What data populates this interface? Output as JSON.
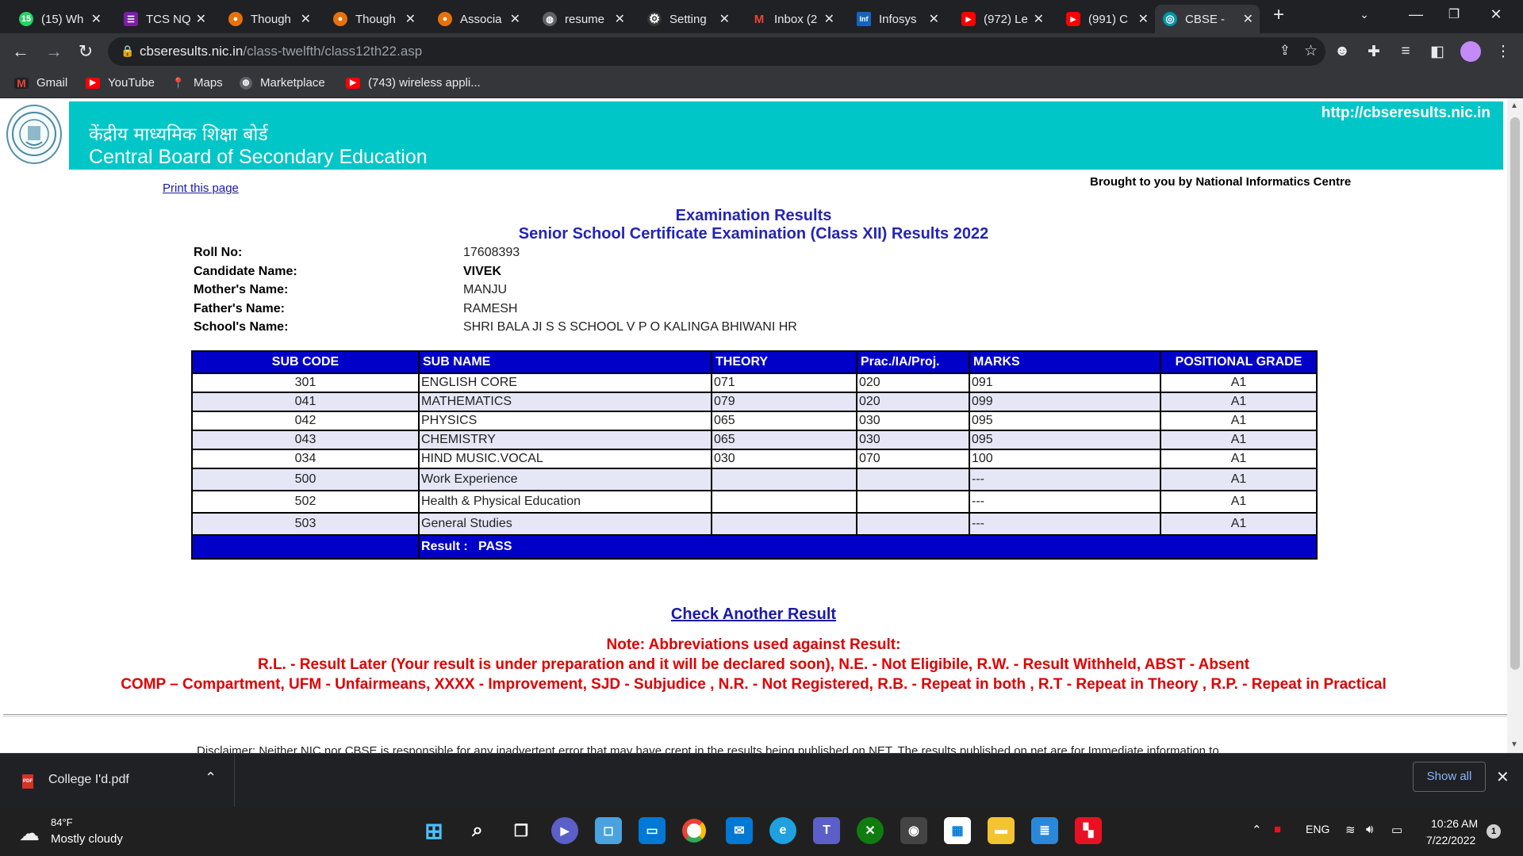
{
  "browser": {
    "tabs": [
      {
        "label": "(15) Wh",
        "icon": "whatsapp-icon",
        "color": "#25d366",
        "glyph": "15"
      },
      {
        "label": "TCS NQ",
        "icon": "tcs-icon",
        "color": "#7b1fa2",
        "glyph": "☰"
      },
      {
        "label": "Though",
        "icon": "bulb-icon",
        "color": "#e8710a",
        "glyph": "●"
      },
      {
        "label": "Though",
        "icon": "bulb-icon",
        "color": "#e8710a",
        "glyph": "●"
      },
      {
        "label": "Associa",
        "icon": "bulb-icon",
        "color": "#e8710a",
        "glyph": "●"
      },
      {
        "label": "resume",
        "icon": "globe-icon",
        "color": "#5f6368",
        "glyph": "◍"
      },
      {
        "label": "Setting",
        "icon": "gear-icon",
        "color": "#35363a",
        "glyph": "⚙"
      },
      {
        "label": "Inbox (2",
        "icon": "gmail-icon",
        "color": "#202124",
        "glyph": "M"
      },
      {
        "label": "Infosys",
        "icon": "infosys-icon",
        "color": "#1565c0",
        "glyph": "Inf"
      },
      {
        "label": "(972) Le",
        "icon": "youtube-icon",
        "color": "#ff0000",
        "glyph": "▶"
      },
      {
        "label": "(991) C",
        "icon": "youtube-icon",
        "color": "#ff0000",
        "glyph": "▶"
      },
      {
        "label": "CBSE - ",
        "icon": "cbse-icon",
        "color": "#0097a7",
        "glyph": "◎"
      }
    ],
    "new_tab": "+",
    "url_host": "cbseresults.nic.in",
    "url_path": "/class-twelfth/class12th22.asp",
    "bookmarks": [
      {
        "label": "Gmail",
        "icon": "gmail-icon",
        "color": "#202124",
        "glyph": "M"
      },
      {
        "label": "YouTube",
        "icon": "youtube-icon",
        "color": "#ff0000",
        "glyph": "▶"
      },
      {
        "label": "Maps",
        "icon": "maps-icon",
        "color": "#35363a",
        "glyph": "📍"
      },
      {
        "label": "Marketplace",
        "icon": "globe-icon",
        "color": "#5f6368",
        "glyph": "◍"
      },
      {
        "label": "(743) wireless appli...",
        "icon": "youtube-icon",
        "color": "#ff0000",
        "glyph": "▶"
      }
    ]
  },
  "page": {
    "banner_hindi": "केंद्रीय माध्यमिक शिक्षा बोर्ड",
    "banner_english": "Central Board of Secondary Education",
    "banner_url": "http://cbseresults.nic.in",
    "print_link": "Print this page",
    "nic_credit": "Brought to you by National Informatics Centre",
    "title": "Examination Results",
    "subtitle": "Senior School Certificate Examination (Class XII) Results 2022",
    "candidate": [
      {
        "label": "Roll No:",
        "value": "17608393"
      },
      {
        "label": "Candidate Name:",
        "value": "VIVEK"
      },
      {
        "label": "Mother's Name:",
        "value": "MANJU"
      },
      {
        "label": "Father's Name:",
        "value": "RAMESH"
      },
      {
        "label": "School's Name:",
        "value": "SHRI BALA JI S S SCHOOL V P O KALINGA BHIWANI HR"
      }
    ],
    "table_headers": [
      "SUB CODE",
      "SUB NAME",
      "THEORY",
      "Prac./IA/Proj.",
      "MARKS",
      "POSITIONAL GRADE"
    ],
    "subjects": [
      {
        "code": "301",
        "name": "ENGLISH CORE",
        "theory": "071",
        "prac": "020",
        "marks": "091",
        "grade": "A1"
      },
      {
        "code": "041",
        "name": "MATHEMATICS",
        "theory": "079",
        "prac": "020",
        "marks": "099",
        "grade": "A1"
      },
      {
        "code": "042",
        "name": "PHYSICS",
        "theory": "065",
        "prac": "030",
        "marks": "095",
        "grade": "A1"
      },
      {
        "code": "043",
        "name": "CHEMISTRY",
        "theory": "065",
        "prac": "030",
        "marks": "095",
        "grade": "A1"
      },
      {
        "code": "034",
        "name": "HIND MUSIC.VOCAL",
        "theory": "030",
        "prac": "070",
        "marks": "100",
        "grade": "A1"
      },
      {
        "code": "500",
        "name": "Work Experience",
        "theory": "",
        "prac": "",
        "marks": "---",
        "grade": "A1"
      },
      {
        "code": "502",
        "name": "Health & Physical Education",
        "theory": "",
        "prac": "",
        "marks": "---",
        "grade": "A1"
      },
      {
        "code": "503",
        "name": "General Studies",
        "theory": "",
        "prac": "",
        "marks": "---",
        "grade": "A1"
      }
    ],
    "result_label": "Result :",
    "result_value": "PASS",
    "check_another": "Check Another Result",
    "note_title": "Note: Abbreviations used against Result:",
    "note_line1": "R.L. - Result Later (Your result is under preparation and it will be declared soon), N.E. - Not Eligibile, R.W. - Result Withheld, ABST - Absent",
    "note_line2": "COMP – Compartment, UFM - Unfairmeans, XXXX - Improvement, SJD - Subjudice , N.R. - Not Registered, R.B. - Repeat in both , R.T - Repeat in Theory , R.P. - Repeat in Practical",
    "disclaimer": "Disclaimer: Neither NIC nor CBSE is responsible for any inadvertent error that may have crept in the results being published on NET. The results published on net are for Immediate information to"
  },
  "downloads": {
    "file": "College I'd.pdf",
    "file_icon": "PDF",
    "show_all": "Show all"
  },
  "taskbar": {
    "temp": "84°F",
    "weather": "Mostly cloudy",
    "lang": "ENG",
    "time": "10:26 AM",
    "date": "7/22/2022",
    "notifications": "1"
  },
  "colors": {
    "banner": "#00c6c8",
    "table_header": "#0000c8",
    "link": "#1a1aa6",
    "note": "#e00000",
    "title": "#2424b4"
  }
}
